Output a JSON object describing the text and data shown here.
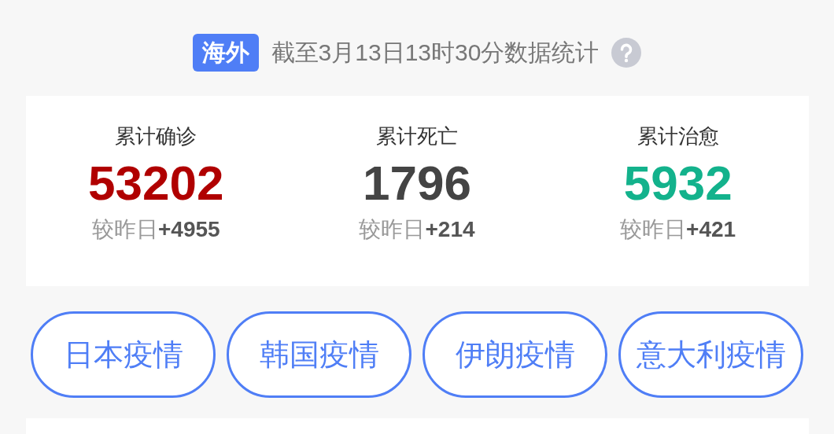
{
  "header": {
    "badge": "海外",
    "caption": "截至3月13日13时30分数据统计"
  },
  "stats": [
    {
      "label": "累计确诊",
      "value": "53202",
      "change": "较昨日**+4955**",
      "color": "#b00000"
    },
    {
      "label": "累计死亡",
      "value": "1796",
      "change": "较昨日**+214**",
      "color": "#444444"
    },
    {
      "label": "累计治愈",
      "value": "5932",
      "change": "较昨日**+421**",
      "color": "#13b28c"
    }
  ],
  "links": [
    "日本疫情",
    "韩国疫情",
    "伊朗疫情",
    "意大利疫情"
  ]
}
